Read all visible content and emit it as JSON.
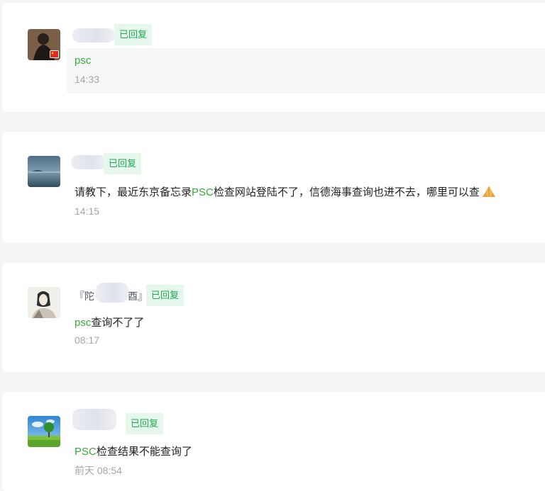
{
  "comments": [
    {
      "badge": "已回复",
      "message": {
        "highlight": "psc",
        "rest": ""
      },
      "time": "14:33"
    },
    {
      "badge": "已回复",
      "message": {
        "before": "请教下，最近东京备忘录",
        "highlight": "PSC",
        "after": "检查网站登陆不了，信德海事查询也进不去，哪里可以查"
      },
      "time": "14:15"
    },
    {
      "name_left": "『陀",
      "name_right": "酉』",
      "badge": "已回复",
      "message": {
        "highlight": "psc",
        "rest": "查询不了了"
      },
      "time": "08:17"
    },
    {
      "badge": "已回复",
      "message": {
        "highlight": "PSC",
        "rest": "检查结果不能查询了"
      },
      "time": "前天 08:54"
    }
  ],
  "colors": {
    "background": "#f4f5f7",
    "card": "#ffffff",
    "highlight": "#3aa83a",
    "badge_bg": "#e6f7ec",
    "badge_text": "#21a657",
    "time": "#a3a7ad"
  },
  "icons": [
    "avatar-person",
    "avatar-china-flag-badge",
    "avatar-lake",
    "avatar-ink-portrait",
    "avatar-landscape",
    "pray-hands-emoji"
  ]
}
